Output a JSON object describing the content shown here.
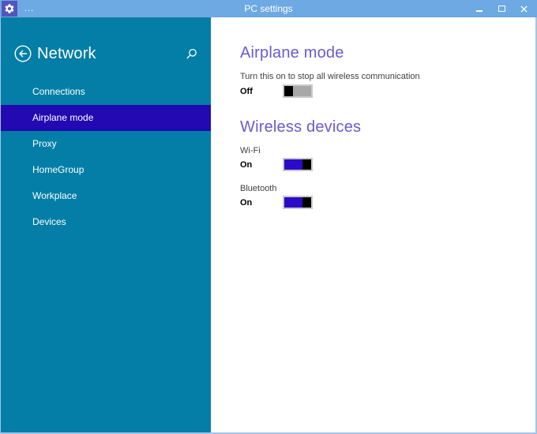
{
  "window": {
    "title": "PC settings",
    "overflow_label": "...",
    "app_icon": "gear-icon",
    "controls": {
      "minimize": "minimize-icon",
      "maximize": "maximize-icon",
      "close": "close-icon"
    }
  },
  "sidebar": {
    "title": "Network",
    "back_icon": "back-arrow-icon",
    "search_icon": "search-icon",
    "selected_item": "Airplane mode",
    "items": [
      {
        "label": "Connections"
      },
      {
        "label": "Airplane mode"
      },
      {
        "label": "Proxy"
      },
      {
        "label": "HomeGroup"
      },
      {
        "label": "Workplace"
      },
      {
        "label": "Devices"
      }
    ]
  },
  "content": {
    "airplane_section": {
      "heading": "Airplane mode",
      "description": "Turn this on to stop all wireless communication",
      "toggle": {
        "state": "Off",
        "on": false
      }
    },
    "wireless_section": {
      "heading": "Wireless devices",
      "devices": [
        {
          "label": "Wi-Fi",
          "state": "On",
          "on": true
        },
        {
          "label": "Bluetooth",
          "state": "On",
          "on": true
        }
      ]
    }
  },
  "colors": {
    "titlebar": "#6da9e3",
    "window_border": "#a3c4ea",
    "app_tile": "#5355bf",
    "sidebar": "#047ea6",
    "selected_item": "#2209b2",
    "heading": "#6a5bcb",
    "toggle_on": "#2b0bc7",
    "toggle_off_track": "#a8a8a8",
    "toggle_border": "#c9c9c9"
  }
}
